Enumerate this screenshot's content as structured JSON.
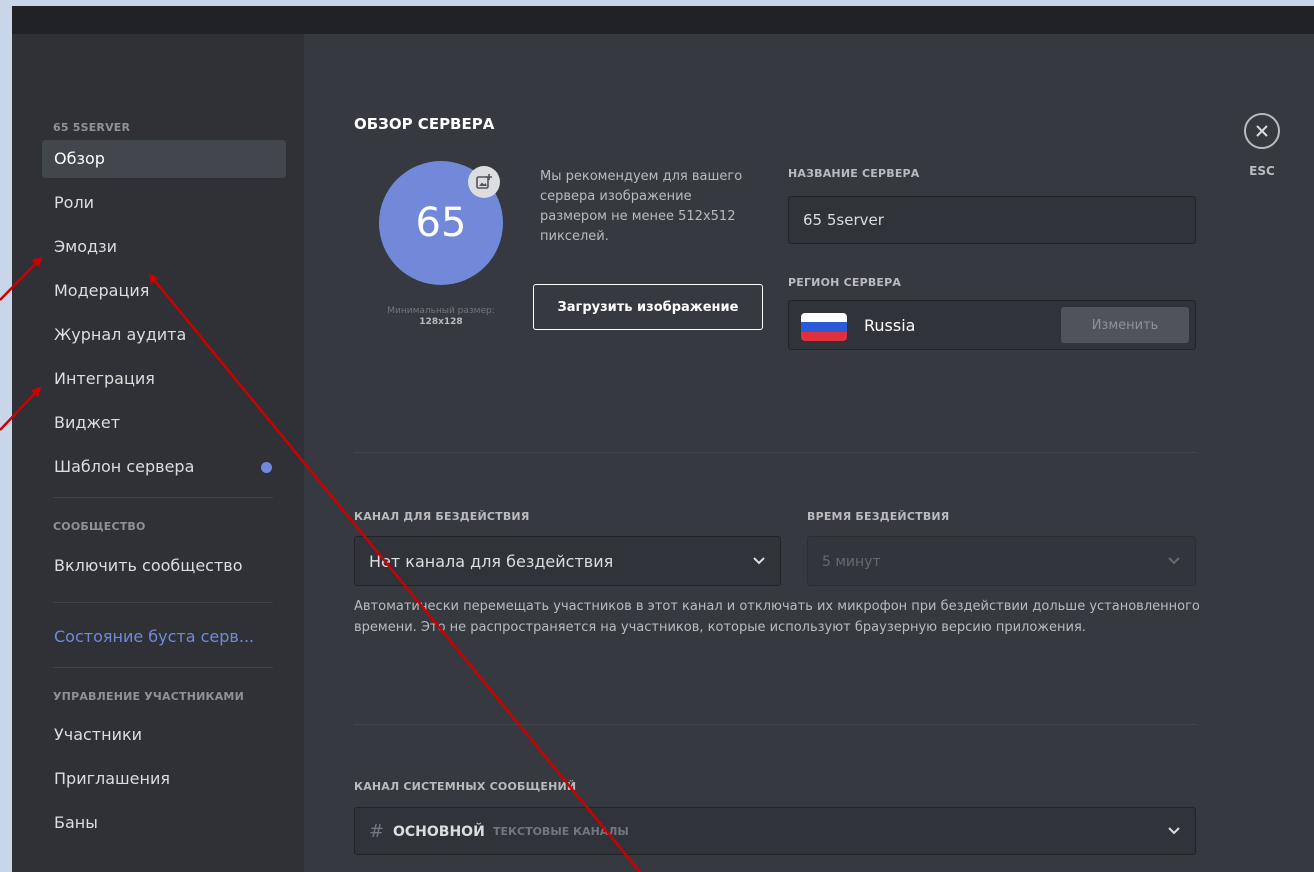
{
  "sidebar": {
    "server_header": "65 5SERVER",
    "items": [
      {
        "label": "Обзор",
        "selected": true
      },
      {
        "label": "Роли"
      },
      {
        "label": "Эмодзи"
      },
      {
        "label": "Модерация"
      },
      {
        "label": "Журнал аудита"
      },
      {
        "label": "Интеграция"
      },
      {
        "label": "Виджет"
      },
      {
        "label": "Шаблон сервера",
        "badge": true
      }
    ],
    "community_header": "СООБЩЕСТВО",
    "community_items": [
      {
        "label": "Включить сообщество"
      }
    ],
    "boost_item": "Состояние буста серв...",
    "members_header": "УПРАВЛЕНИЕ УЧАСТНИКАМИ",
    "members_items": [
      {
        "label": "Участники"
      },
      {
        "label": "Приглашения"
      },
      {
        "label": "Баны"
      }
    ]
  },
  "overview": {
    "title": "ОБЗОР СЕРВЕРА",
    "avatar_text": "65",
    "min_size_label": "Минимальный размер:",
    "min_size_value": "128x128",
    "recommend_text": "Мы рекомендуем для вашего сервера изображение размером не менее 512x512 пикселей.",
    "upload_button": "Загрузить изображение",
    "server_name_label": "НАЗВАНИЕ СЕРВЕРА",
    "server_name_value": "65 5server",
    "region_label": "РЕГИОН СЕРВЕРА",
    "region_value": "Russia",
    "region_change": "Изменить"
  },
  "afk": {
    "channel_label": "КАНАЛ ДЛЯ БЕЗДЕЙСТВИЯ",
    "channel_value": "Нет канала для бездействия",
    "timeout_label": "ВРЕМЯ БЕЗДЕЙСТВИЯ",
    "timeout_value": "5 минут",
    "description": "Автоматически перемещать участников в этот канал и отключать их микрофон при бездействии дольше установленного времени. Это не распространяется на участников, которые используют браузерную версию приложения."
  },
  "system": {
    "label": "КАНАЛ СИСТЕМНЫХ СООБЩЕНИЙ",
    "channel_hash": "#",
    "channel_name": "основной",
    "channel_category": "ТЕКСТОВЫЕ КАНАЛЫ"
  },
  "close": {
    "esc_label": "ESC"
  },
  "colors": {
    "accent": "#7289da",
    "background": "#36393f",
    "sidebar": "#2f3136",
    "annotation_arrow": "#cc0000"
  }
}
